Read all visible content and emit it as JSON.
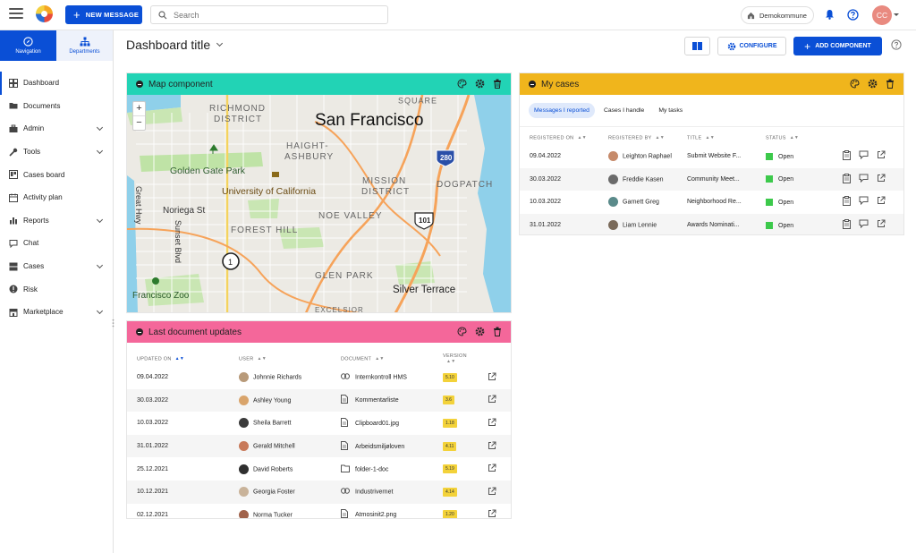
{
  "topbar": {
    "new_message_label": "NEW MESSAGE",
    "search_placeholder": "Search",
    "kommune_label": "Demokommune",
    "avatar_initials": "CC"
  },
  "sidebar": {
    "tabs": [
      {
        "label": "Navigation"
      },
      {
        "label": "Departments"
      }
    ],
    "items": [
      {
        "label": "Dashboard"
      },
      {
        "label": "Documents"
      },
      {
        "label": "Admin"
      },
      {
        "label": "Tools"
      },
      {
        "label": "Cases board"
      },
      {
        "label": "Activity plan"
      },
      {
        "label": "Reports"
      },
      {
        "label": "Chat"
      },
      {
        "label": "Cases"
      },
      {
        "label": "Risk"
      },
      {
        "label": "Marketplace"
      }
    ]
  },
  "header": {
    "title": "Dashboard title",
    "configure_label": "CONFIGURE",
    "add_component_label": "ADD COMPONENT"
  },
  "map_panel": {
    "title": "Map component",
    "header_color": "#22d3b5",
    "zoom_in": "+",
    "zoom_out": "−",
    "labels": {
      "city": "San Francisco",
      "richmond": "RICHMOND",
      "district": "DISTRICT",
      "haight": "HAIGHT-",
      "ashbury": "ASHBURY",
      "ggpark": "Golden Gate Park",
      "uc": "University of California",
      "noriega": "Noriega St",
      "mission": "MISSION",
      "mission2": "DISTRICT",
      "dogpatch": "DOGPATCH",
      "noevalley": "NOE VALLEY",
      "foresthill": "FOREST HILL",
      "greathwy": "Great Hwy",
      "sunset": "Sunset Blvd",
      "glenpark": "GLEN PARK",
      "silver": "Silver Terrace",
      "zoo": "Francisco Zoo",
      "square": "SQUARE",
      "excelsior": "EXCELSIOR",
      "hwy280": "280",
      "hwy101": "101",
      "cluster": "1"
    }
  },
  "docs_panel": {
    "title": "Last document updates",
    "header_color": "#f4679a",
    "columns": [
      "UPDATED ON",
      "USER",
      "DOCUMENT",
      "VERSION"
    ],
    "rows": [
      {
        "date": "09.04.2022",
        "user": "Johnnie Richards",
        "doc": "Internkontroll HMS",
        "version": "5.10",
        "icon": "link-icon",
        "avatar": "#b89a7a"
      },
      {
        "date": "30.03.2022",
        "user": "Ashley Young",
        "doc": "Kommentarliste",
        "version": "3.6",
        "icon": "file-icon",
        "avatar": "#d9a46b"
      },
      {
        "date": "10.03.2022",
        "user": "Sheila Barrett",
        "doc": "Clipboard01.jpg",
        "version": "1.18",
        "icon": "file-icon",
        "avatar": "#3b3b3b"
      },
      {
        "date": "31.01.2022",
        "user": "Gerald Mitchell",
        "doc": "Arbeidsmiljøloven",
        "version": "4.11",
        "icon": "file-icon",
        "avatar": "#c87a5a"
      },
      {
        "date": "25.12.2021",
        "user": "David Roberts",
        "doc": "folder-1-doc",
        "version": "5.19",
        "icon": "folder-icon",
        "avatar": "#2f2f2f"
      },
      {
        "date": "10.12.2021",
        "user": "Georgia Foster",
        "doc": "Industrivernet",
        "version": "4.14",
        "icon": "link-icon",
        "avatar": "#c9b39a"
      },
      {
        "date": "02.12.2021",
        "user": "Norma Tucker",
        "doc": "Atmosinit2.png",
        "version": "1.20",
        "icon": "file-icon",
        "avatar": "#a0624a"
      }
    ]
  },
  "cases_panel": {
    "title": "My cases",
    "header_color": "#f0b51c",
    "tabs": [
      "Messages I reported",
      "Cases I handle",
      "My tasks"
    ],
    "columns": [
      "REGISTERED ON",
      "REGISTERED BY",
      "TITLE",
      "STATUS"
    ],
    "rows": [
      {
        "date": "09.04.2022",
        "by": "Leighton Raphael",
        "title": "Submit Website F...",
        "status": "Open",
        "avatar": "#c68a6a"
      },
      {
        "date": "30.03.2022",
        "by": "Freddie Kasen",
        "title": "Community Meet...",
        "status": "Open",
        "avatar": "#6a6a6a"
      },
      {
        "date": "10.03.2022",
        "by": "Garnett Greg",
        "title": "Neighborhood Re...",
        "status": "Open",
        "avatar": "#5a8a8a"
      },
      {
        "date": "31.01.2022",
        "by": "Liam Lennie",
        "title": "Awards Nominati...",
        "status": "Open",
        "avatar": "#7a6a5a"
      }
    ]
  }
}
